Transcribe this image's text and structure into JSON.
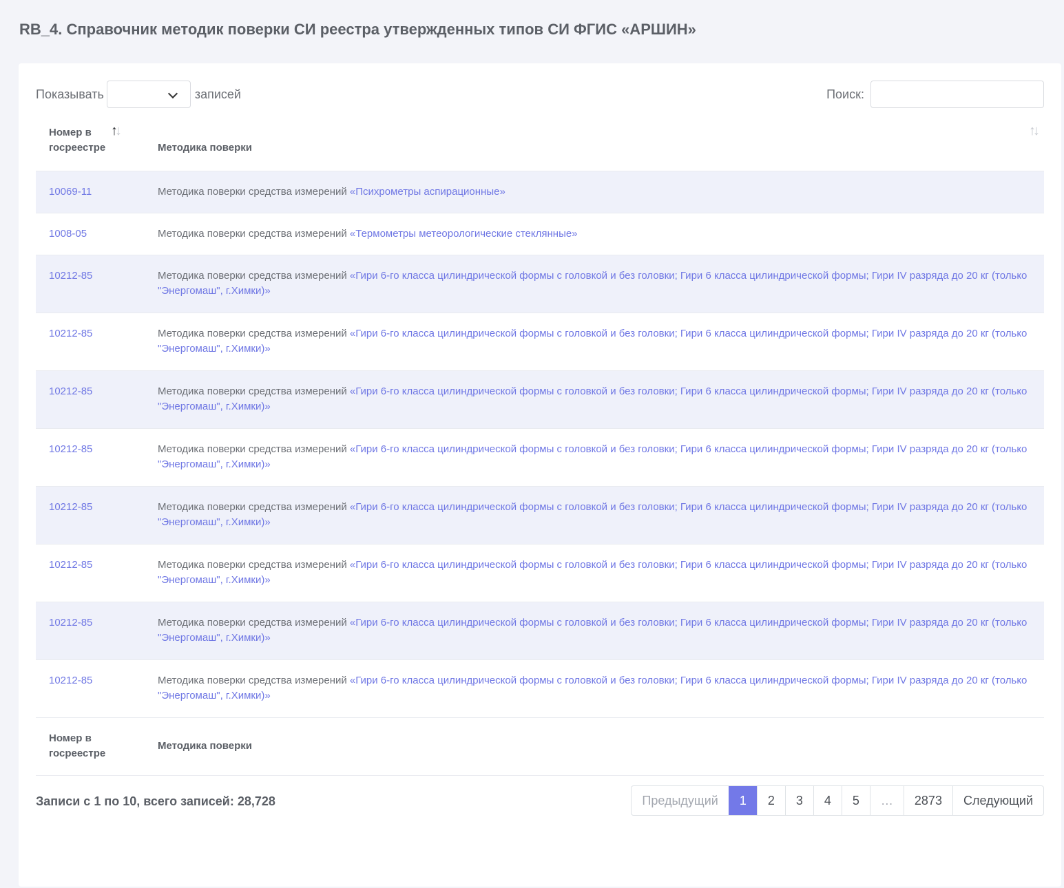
{
  "page": {
    "title": "RB_4. Справочник методик поверки СИ реестра утвержденных типов СИ ФГИС «АРШИН»"
  },
  "controls": {
    "show_label": "Показывать",
    "entries_label": "записей",
    "length_value": "",
    "search_label": "Поиск:",
    "search_value": ""
  },
  "table": {
    "columns": [
      "Номер в госреестре",
      "Методика поверки"
    ],
    "rows": [
      {
        "number": "10069-11",
        "prefix": "Методика поверки средства измерений ",
        "name": "«Психрометры аспирационные»"
      },
      {
        "number": "1008-05",
        "prefix": "Методика поверки средства измерений ",
        "name": "«Термометры метеорологические стеклянные»"
      },
      {
        "number": "10212-85",
        "prefix": "Методика поверки средства измерений ",
        "name": "«Гири 6-го класса цилиндрической формы с головкой и без головки; Гири 6 класса цилиндрической формы; Гири IV разряда до 20 кг (только \"Энергомаш\", г.Химки)»"
      },
      {
        "number": "10212-85",
        "prefix": "Методика поверки средства измерений ",
        "name": "«Гири 6-го класса цилиндрической формы с головкой и без головки; Гири 6 класса цилиндрической формы; Гири IV разряда до 20 кг (только \"Энергомаш\", г.Химки)»"
      },
      {
        "number": "10212-85",
        "prefix": "Методика поверки средства измерений ",
        "name": "«Гири 6-го класса цилиндрической формы с головкой и без головки; Гири 6 класса цилиндрической формы; Гири IV разряда до 20 кг (только \"Энергомаш\", г.Химки)»"
      },
      {
        "number": "10212-85",
        "prefix": "Методика поверки средства измерений ",
        "name": "«Гири 6-го класса цилиндрической формы с головкой и без головки; Гири 6 класса цилиндрической формы; Гири IV разряда до 20 кг (только \"Энергомаш\", г.Химки)»"
      },
      {
        "number": "10212-85",
        "prefix": "Методика поверки средства измерений ",
        "name": "«Гири 6-го класса цилиндрической формы с головкой и без головки; Гири 6 класса цилиндрической формы; Гири IV разряда до 20 кг (только \"Энергомаш\", г.Химки)»"
      },
      {
        "number": "10212-85",
        "prefix": "Методика поверки средства измерений ",
        "name": "«Гири 6-го класса цилиндрической формы с головкой и без головки; Гири 6 класса цилиндрической формы; Гири IV разряда до 20 кг (только \"Энергомаш\", г.Химки)»"
      },
      {
        "number": "10212-85",
        "prefix": "Методика поверки средства измерений ",
        "name": "«Гири 6-го класса цилиндрической формы с головкой и без головки; Гири 6 класса цилиндрической формы; Гири IV разряда до 20 кг (только \"Энергомаш\", г.Химки)»"
      },
      {
        "number": "10212-85",
        "prefix": "Методика поверки средства измерений ",
        "name": "«Гири 6-го класса цилиндрической формы с головкой и без головки; Гири 6 класса цилиндрической формы; Гири IV разряда до 20 кг (только \"Энергомаш\", г.Химки)»"
      }
    ]
  },
  "footer": {
    "info": "Записи с 1 по 10, всего записей: 28,728"
  },
  "pagination": {
    "prev": "Предыдущий",
    "pages": [
      "1",
      "2",
      "3",
      "4",
      "5"
    ],
    "ellipsis": "…",
    "last": "2873",
    "next": "Следующий",
    "active": "1"
  },
  "icons": {
    "sort": "sort-arrows-icon",
    "dropdown": "chevron-down-icon"
  },
  "colors": {
    "link": "#6f77e4",
    "active_page": "#7379e8",
    "striped_row": "#eff1fa"
  }
}
